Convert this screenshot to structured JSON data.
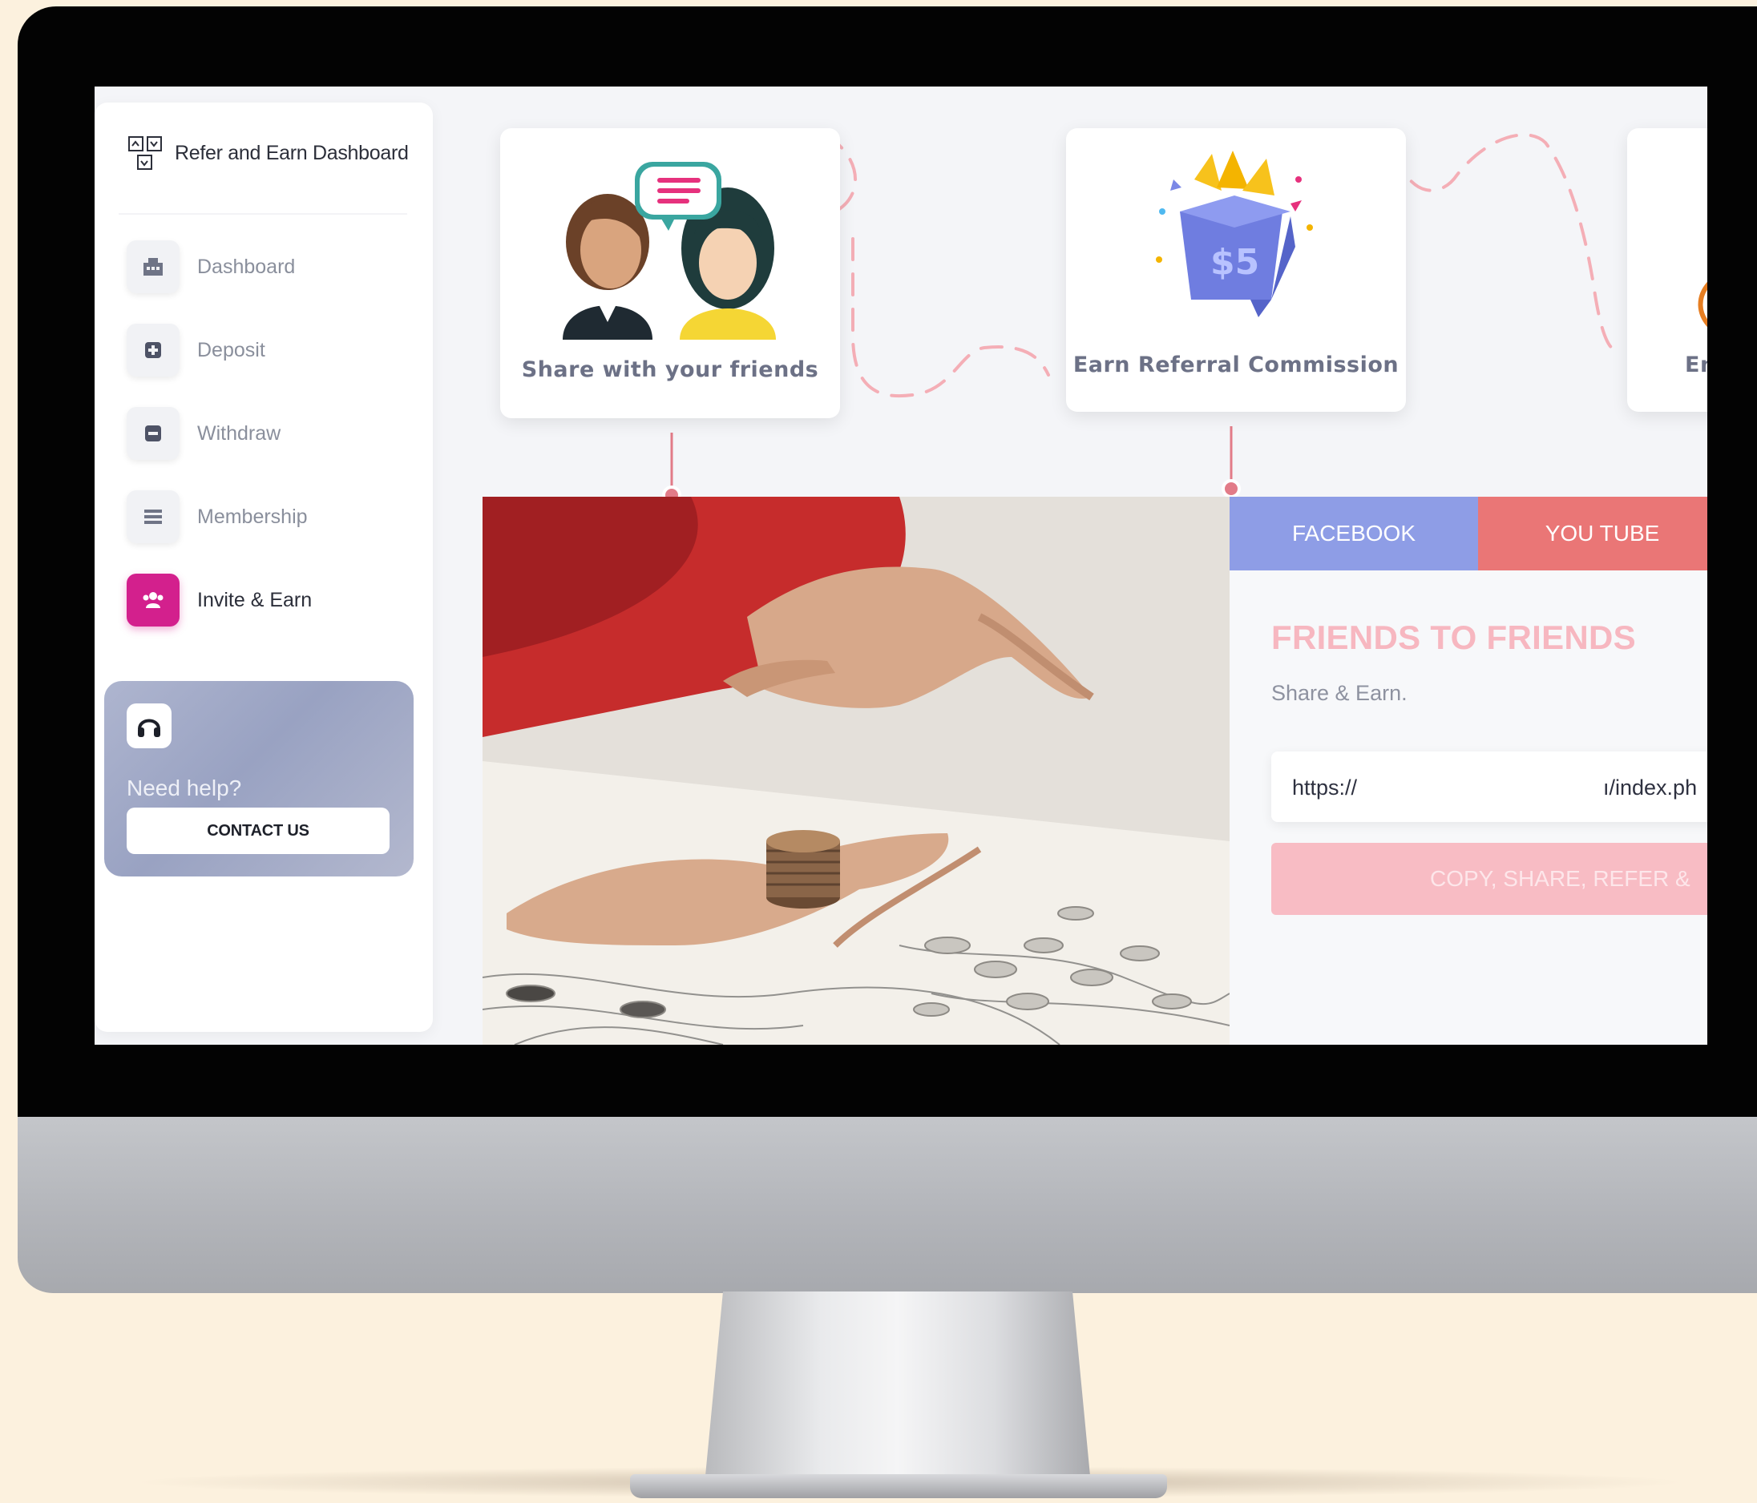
{
  "brand": {
    "title": "Refer and Earn Dashboard",
    "logo_icon": "referral-logo-icon"
  },
  "sidebar": {
    "items": [
      {
        "label": "Dashboard",
        "icon": "dashboard-icon",
        "active": false
      },
      {
        "label": "Deposit",
        "icon": "plus-square-icon",
        "active": false
      },
      {
        "label": "Withdraw",
        "icon": "minus-square-icon",
        "active": false
      },
      {
        "label": "Membership",
        "icon": "list-icon",
        "active": false
      },
      {
        "label": "Invite & Earn",
        "icon": "users-icon",
        "active": true
      }
    ],
    "help": {
      "text": "Need help?",
      "button": "CONTACT US",
      "icon": "headphones-icon"
    }
  },
  "steps": [
    {
      "label": "Share with your friends",
      "icon": "friends-chat-illustration"
    },
    {
      "label": "Earn Referral Commission",
      "icon": "gift-box-illustration",
      "badge": "$5"
    },
    {
      "label": "En",
      "icon": "partial-illustration"
    }
  ],
  "share": {
    "tabs": [
      {
        "label": "FACEBOOK",
        "color": "#8e9de6"
      },
      {
        "label": "YOU TUBE",
        "color": "#ea7676"
      }
    ],
    "title": "FRIENDS TO FRIENDS",
    "subtitle": "Share & Earn.",
    "url_start": "https://",
    "url_end": "ı/index.ph",
    "copy_button": "COPY, SHARE, REFER &"
  },
  "colors": {
    "accent": "#d3208d",
    "dashed_path": "#f4aeb6",
    "facebook": "#8e9de6",
    "youtube": "#ea7676",
    "copy_button": "#f8bcc4"
  }
}
